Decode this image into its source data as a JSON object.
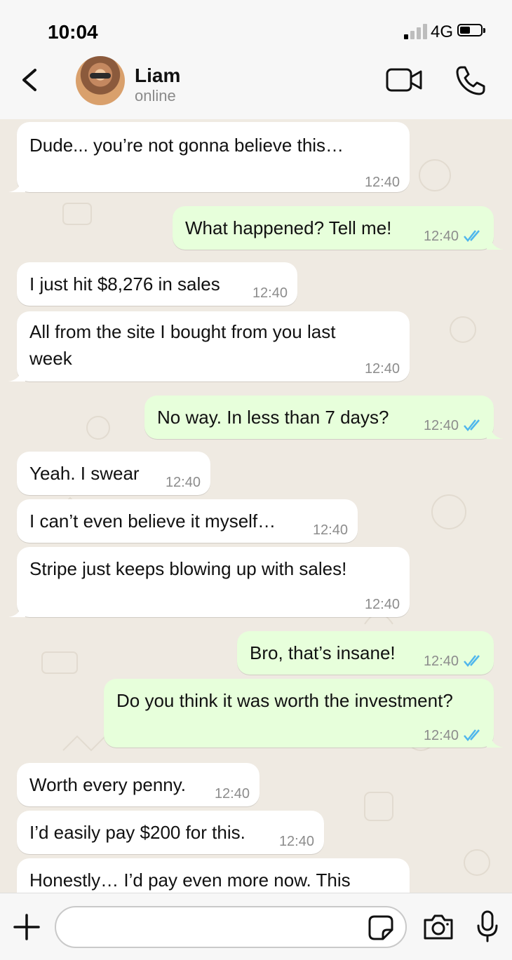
{
  "status_bar": {
    "time": "10:04",
    "network": "4G"
  },
  "header": {
    "contact_name": "Liam",
    "contact_status": "online"
  },
  "messages": [
    {
      "direction": "in",
      "text": "Dude... you’re not gonna believe this…",
      "time": "12:40"
    },
    {
      "direction": "out",
      "text": "What happened? Tell me!",
      "time": "12:40",
      "read": true
    },
    {
      "direction": "in",
      "text": "I just hit $8,276 in sales",
      "time": "12:40"
    },
    {
      "direction": "in",
      "text": "All from the site I bought from you last week",
      "time": "12:40"
    },
    {
      "direction": "out",
      "text": "No way. In less than 7 days?",
      "time": "12:40",
      "read": true
    },
    {
      "direction": "in",
      "text": "Yeah. I swear",
      "time": "12:40"
    },
    {
      "direction": "in",
      "text": "I can’t even believe it myself…",
      "time": "12:40"
    },
    {
      "direction": "in",
      "text": "Stripe just keeps blowing up with sales!",
      "time": "12:40"
    },
    {
      "direction": "out",
      "text": "Bro, that’s insane!",
      "time": "12:40",
      "read": true
    },
    {
      "direction": "out",
      "text": "Do you think it was worth the investment?",
      "time": "12:40",
      "read": true
    },
    {
      "direction": "in",
      "text": "Worth every penny.",
      "time": "12:40"
    },
    {
      "direction": "in",
      "text": "I’d easily pay $200 for this.",
      "time": "12:40"
    },
    {
      "direction": "in",
      "text": "Honestly… I’d pay even more now. This",
      "time": ""
    }
  ],
  "composer": {
    "placeholder": ""
  },
  "colors": {
    "incoming": "#ffffff",
    "outgoing": "#e7ffdb",
    "read_ticks": "#4fb6ec",
    "wallpaper": "#efeae2"
  },
  "icons": [
    "back-chevron-icon",
    "video-call-icon",
    "phone-call-icon",
    "plus-icon",
    "sticker-icon",
    "camera-icon",
    "microphone-icon"
  ]
}
